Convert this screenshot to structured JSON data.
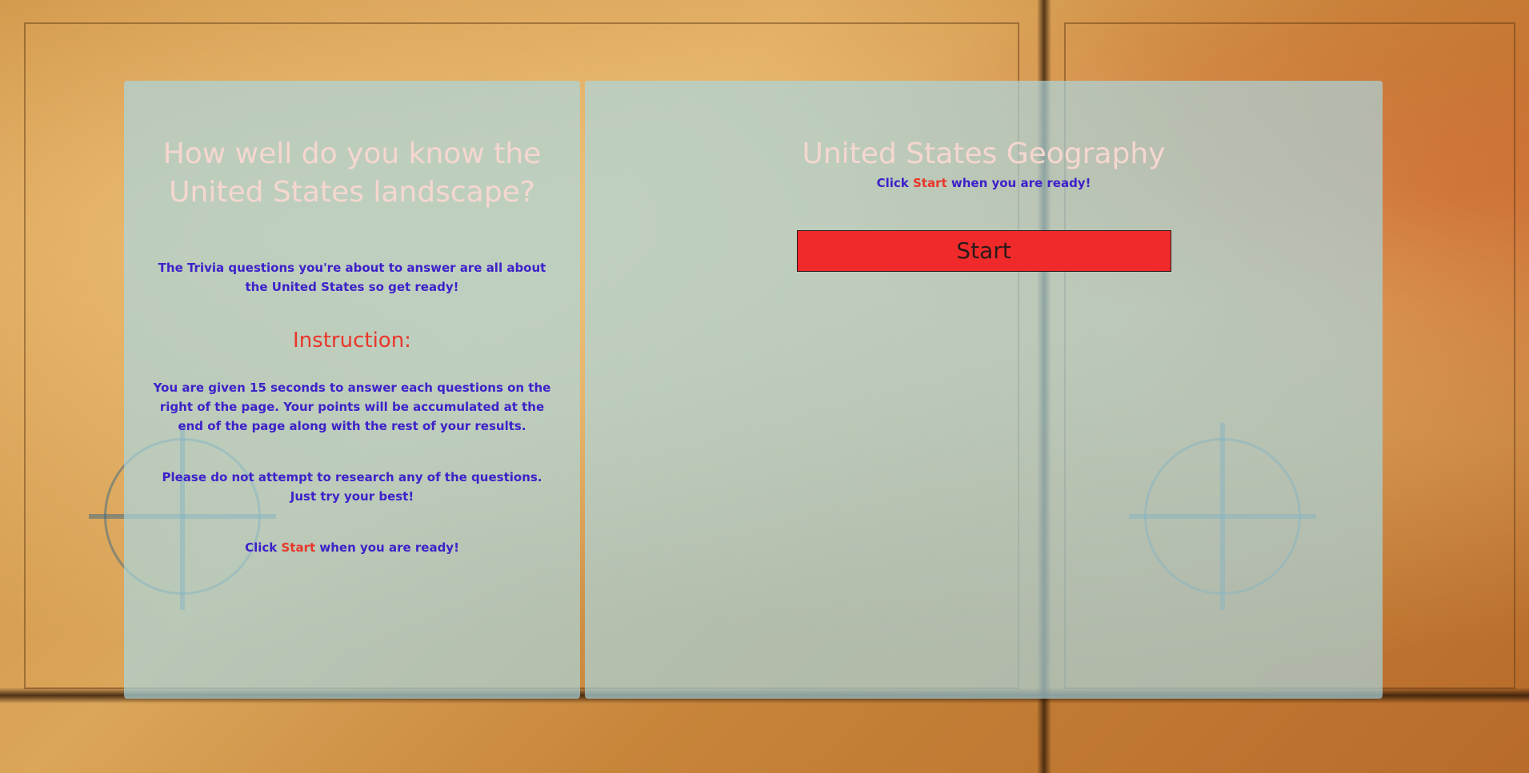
{
  "left_panel": {
    "title": "How well do you know the United States landscape?",
    "intro": "The Trivia questions you're about to answer are all about the United States so get ready!",
    "instruction_heading": "Instruction:",
    "instruction_text": "You are given 15 seconds to answer each questions on the right of the page. Your points will be accumulated at the end of the page along with the rest of your results.",
    "research_note": "Please do not attempt to research any of the questions. Just try your best!",
    "ready_prefix": "Click ",
    "ready_start": "Start",
    "ready_suffix": " when you are ready!"
  },
  "right_panel": {
    "title": "United States Geography",
    "ready_prefix": "Click ",
    "ready_start": "Start",
    "ready_suffix": " when you are ready!",
    "start_button_label": "Start"
  },
  "colors": {
    "panel_bg": "#aad7e1",
    "title_text": "#f5d7cf",
    "body_text": "#3d21c9",
    "accent_red": "#e8362a",
    "button_bg": "#f02a2a"
  }
}
